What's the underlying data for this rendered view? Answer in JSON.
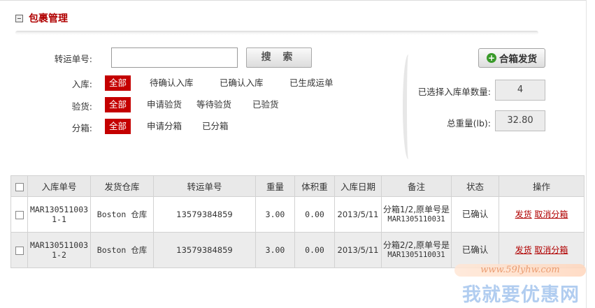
{
  "header": {
    "title": "包裹管理"
  },
  "search": {
    "label": "转运单号:",
    "value": "",
    "button_label": "搜 索"
  },
  "filters": {
    "inbound": {
      "label": "入库:",
      "options": [
        "全部",
        "待确认入库",
        "已确认入库",
        "已生成运单"
      ],
      "active": "全部"
    },
    "inspection": {
      "label": "验货:",
      "options": [
        "全部",
        "申请验货",
        "等待验货",
        "已验货"
      ],
      "active": "全部"
    },
    "split": {
      "label": "分箱:",
      "options": [
        "全部",
        "申请分箱",
        "已分箱"
      ],
      "active": "全部"
    }
  },
  "actions": {
    "combine_button": "合箱发货"
  },
  "summary": {
    "selected_count_label": "已选择入库单数量:",
    "selected_count": "4",
    "total_weight_label": "总重量(lb):",
    "total_weight": "32.80"
  },
  "table": {
    "columns": [
      "入库单号",
      "发货仓库",
      "转运单号",
      "重量",
      "体积重",
      "入库日期",
      "备注",
      "状态",
      "操作"
    ],
    "rows": [
      {
        "order_no": "MAR1305110031-1",
        "warehouse": "Boston 仓库",
        "tracking_no": "13579384859",
        "weight": "3.00",
        "vol_weight": "0.00",
        "date": "2013/5/11",
        "note_line1": "分箱1/2,原单号是",
        "note_line2": "MAR1305110031",
        "status": "已确认",
        "action_ship": "发货",
        "action_cancel": "取消分箱"
      },
      {
        "order_no": "MAR1305110031-2",
        "warehouse": "Boston 仓库",
        "tracking_no": "13579384859",
        "weight": "3.00",
        "vol_weight": "0.00",
        "date": "2013/5/11",
        "note_line1": "分箱2/2,原单号是",
        "note_line2": "MAR1305110031",
        "status": "已确认",
        "action_ship": "发货",
        "action_cancel": "取消分箱"
      }
    ]
  },
  "watermark": {
    "url": "www.59lyhw.com",
    "text": "我就要优惠网"
  },
  "colors": {
    "accent_red": "#c40000",
    "link_red": "#b00000",
    "plus_green": "#3a9a2a"
  }
}
